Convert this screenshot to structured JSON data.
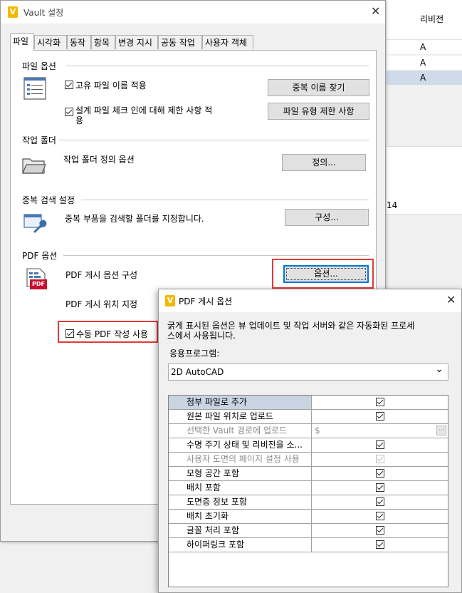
{
  "background": {
    "column_header": "리비전",
    "rows": [
      "A",
      "A",
      "A"
    ],
    "lower_text": "14"
  },
  "main_dialog": {
    "title": "Vault 설정",
    "app_icon_letter": "V",
    "close_symbol": "✕",
    "tabs": [
      "파일",
      "시각화",
      "동작",
      "항목",
      "변경 지시",
      "공동 작업",
      "사용자 객체"
    ],
    "active_tab": "파일",
    "file_options": {
      "title": "파일 옵션",
      "unique_name_label": "고유 파일 이름 적용",
      "unique_name_checked": true,
      "design_checkin_label_line1": "설계 파일 체크 인에 대해 제한 사항 적",
      "design_checkin_label_line2": "용",
      "design_checkin_checked": true,
      "find_duplicates_button": "중복 이름 찾기",
      "file_type_restrict_button": "파일 유형 제한 사항"
    },
    "working_folder": {
      "title": "작업 폴더",
      "description": "작업 폴더 정의 옵션",
      "define_button": "정의..."
    },
    "duplicate_search": {
      "title": "중복 검색 설정",
      "description": "중복 부품을 검색할 폴더를 지정합니다.",
      "configure_button": "구성..."
    },
    "pdf_options": {
      "title": "PDF 옵션",
      "publish_config_label": "PDF 게시 옵션 구성",
      "options_button": "옵션...",
      "publish_location_label": "PDF 게시 위치 지정",
      "manual_pdf_label": "수동 PDF 작성 사용",
      "manual_pdf_checked": true,
      "pdf_icon_text": "PDF"
    }
  },
  "pdf_dialog": {
    "title": "PDF 게시 옵션",
    "app_icon_letter": "V",
    "close_symbol": "✕",
    "note_line1": "굵게 표시된 옵션은 뷰 업데이트 및 작업 서버와 같은 자동화된 프로세",
    "note_line2": "스에서 사용됩니다.",
    "application_label": "응용프로그램:",
    "application_value": "2D AutoCAD",
    "dropdown_arrow": "⌄",
    "properties": [
      {
        "label": "첨부 파일로 추가",
        "type": "check",
        "checked": true,
        "disabled": false,
        "selected": true
      },
      {
        "label": "원본 파일 위치로 업로드",
        "type": "check",
        "checked": true,
        "disabled": false,
        "selected": false
      },
      {
        "label": "선택한 Vault 경로에 업로드",
        "type": "path",
        "value": "$",
        "button": "···",
        "disabled": true,
        "selected": false
      },
      {
        "label": "수명 주기 상태 및 리비전을 소...",
        "type": "check",
        "checked": true,
        "disabled": false,
        "selected": false
      },
      {
        "label": "사용자 도면의 페이지 설정 사용",
        "type": "check",
        "checked": true,
        "disabled": true,
        "selected": false
      },
      {
        "label": "모형 공간 포함",
        "type": "check",
        "checked": true,
        "disabled": false,
        "selected": false
      },
      {
        "label": "배치 포함",
        "type": "check",
        "checked": true,
        "disabled": false,
        "selected": false
      },
      {
        "label": "도면층 정보 포함",
        "type": "check",
        "checked": true,
        "disabled": false,
        "selected": false
      },
      {
        "label": "배치 초기화",
        "type": "check",
        "checked": true,
        "disabled": false,
        "selected": false
      },
      {
        "label": "글꼴 처리 포함",
        "type": "check",
        "checked": true,
        "disabled": false,
        "selected": false
      },
      {
        "label": "하이퍼링크 포함",
        "type": "check",
        "checked": true,
        "disabled": false,
        "selected": false
      }
    ]
  },
  "colors": {
    "accent": "#0078d7",
    "highlight_box": "#e23a3a",
    "selected_row": "#c9d4e3",
    "app_icon": "#f5b800"
  }
}
